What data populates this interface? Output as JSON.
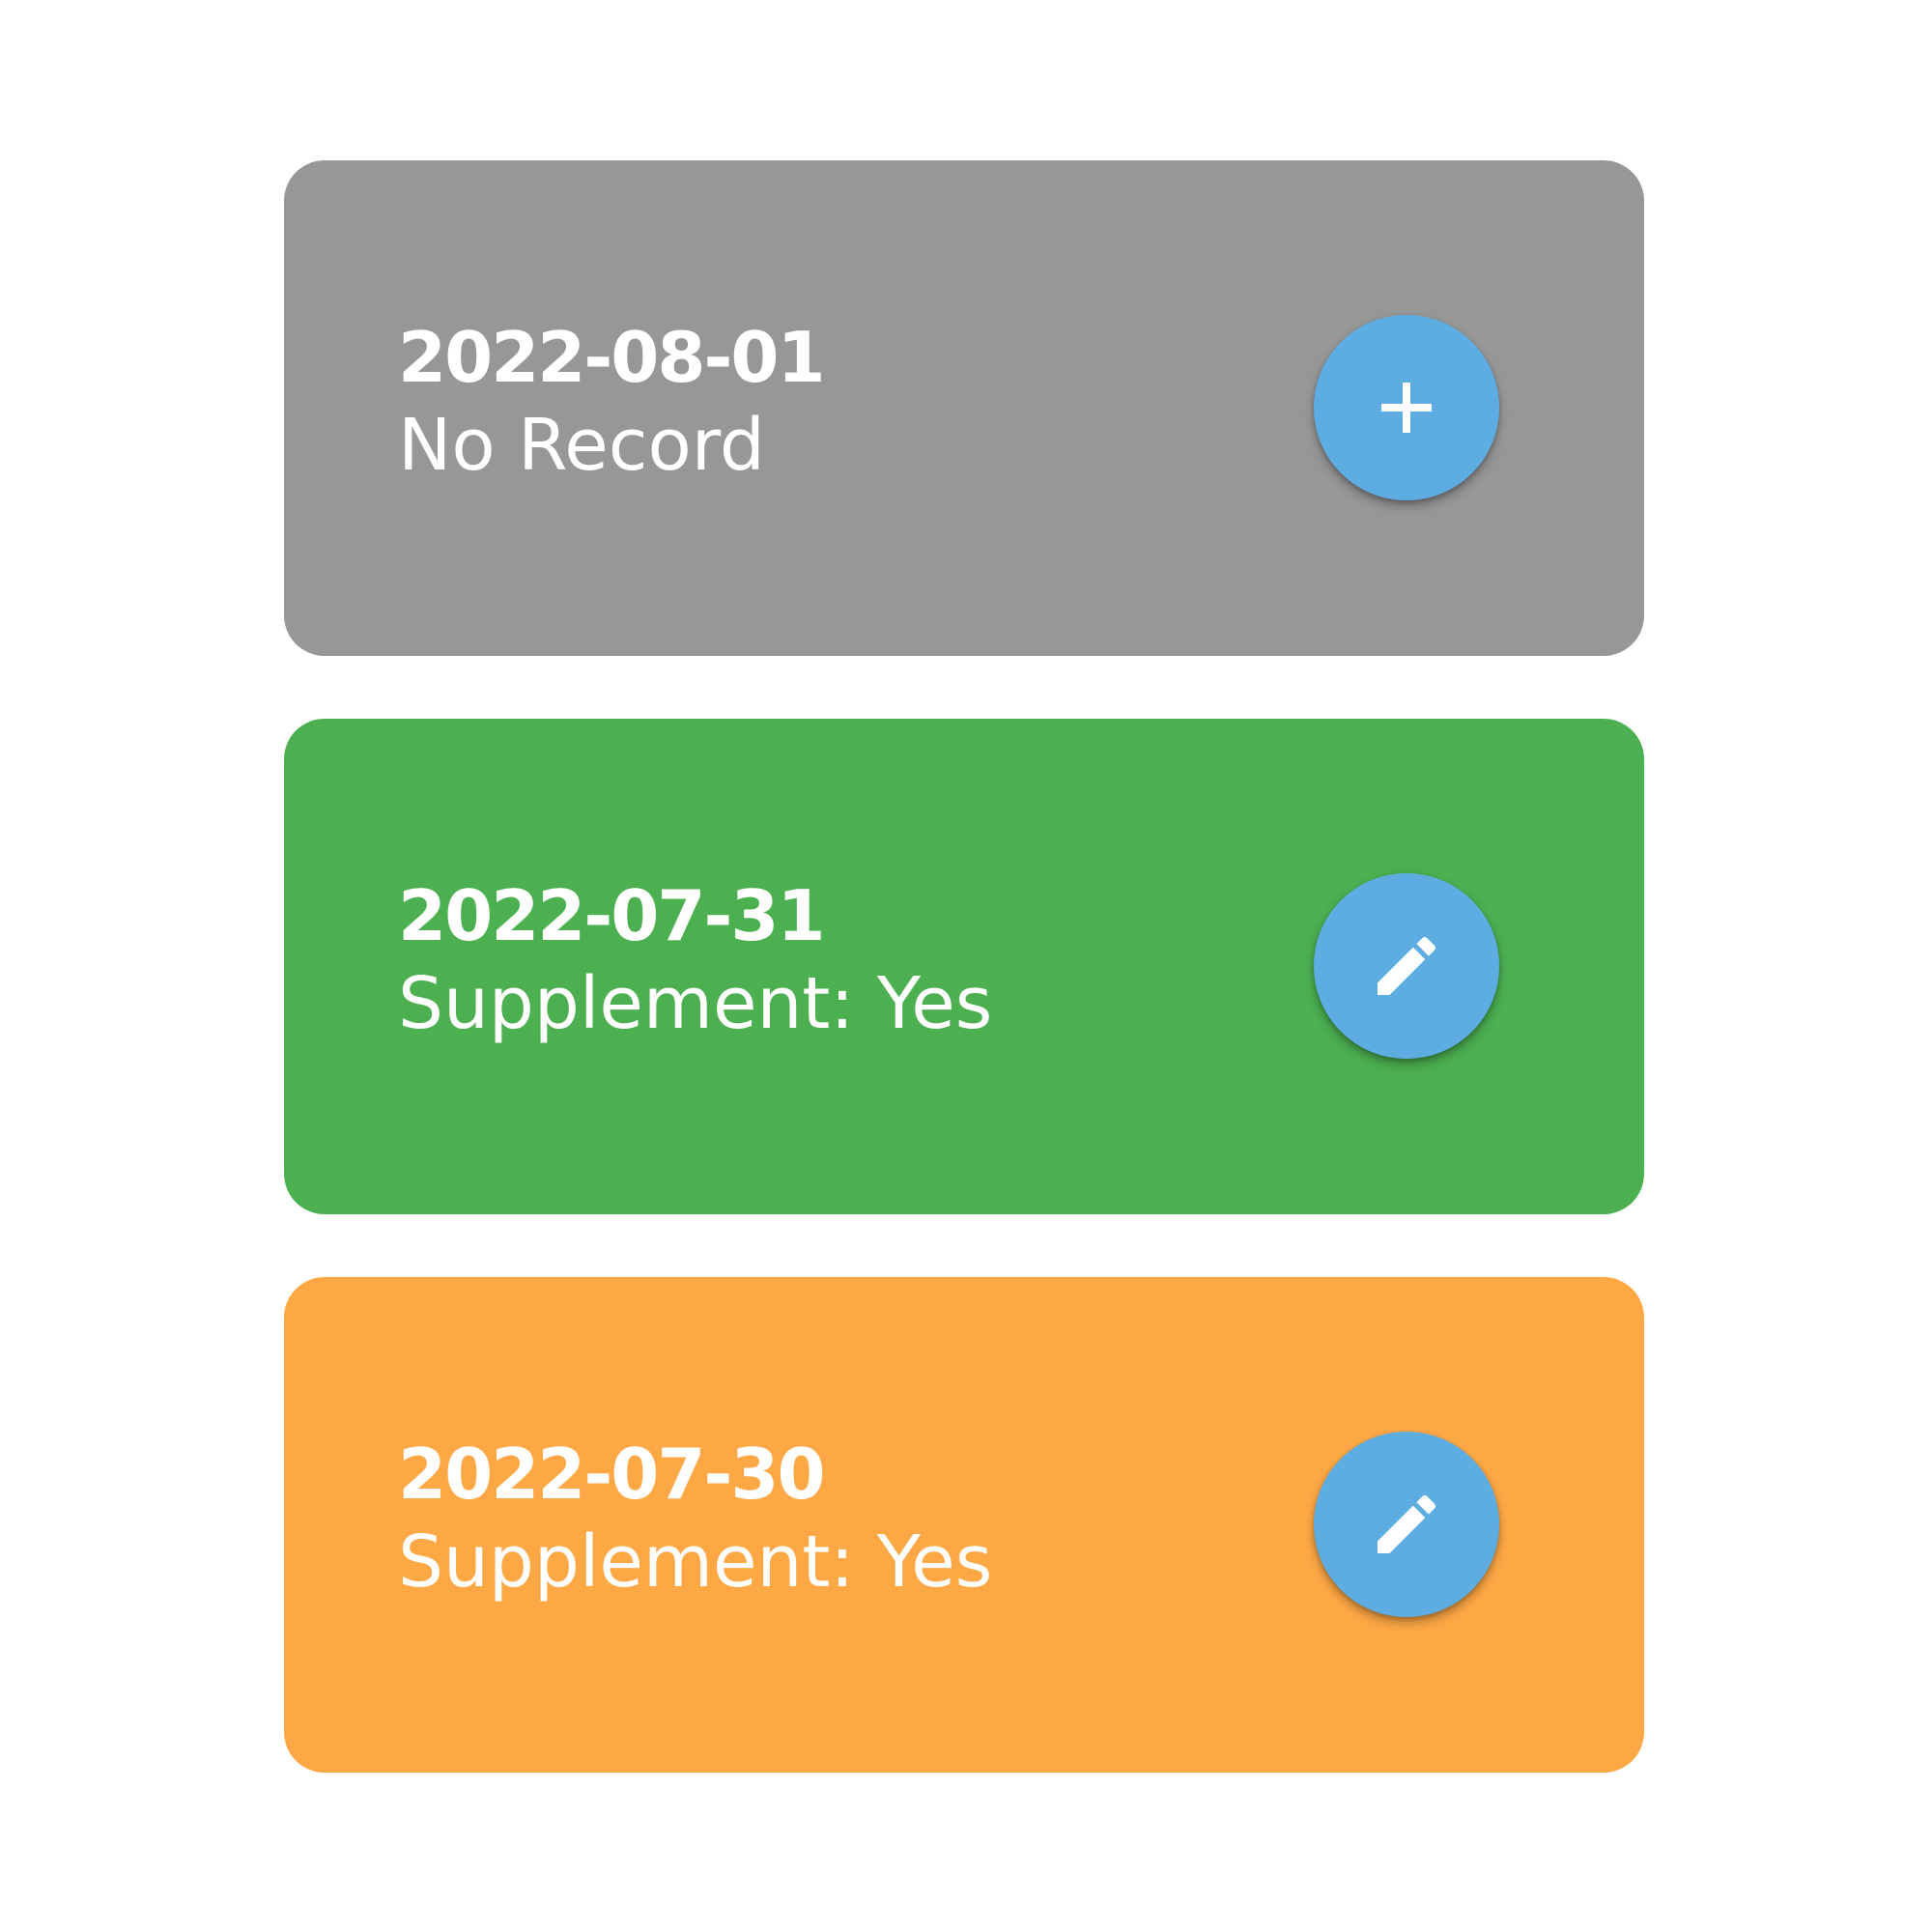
{
  "records": [
    {
      "date": "2022-08-01",
      "status": "No Record",
      "color": "#979797",
      "action_icon": "plus-icon"
    },
    {
      "date": "2022-07-31",
      "status": "Supplement: Yes",
      "color": "#4caf50",
      "action_icon": "pencil-icon"
    },
    {
      "date": "2022-07-30",
      "status": "Supplement: Yes",
      "color": "#fda845",
      "action_icon": "pencil-icon"
    }
  ],
  "accent_color": "#5dade2"
}
